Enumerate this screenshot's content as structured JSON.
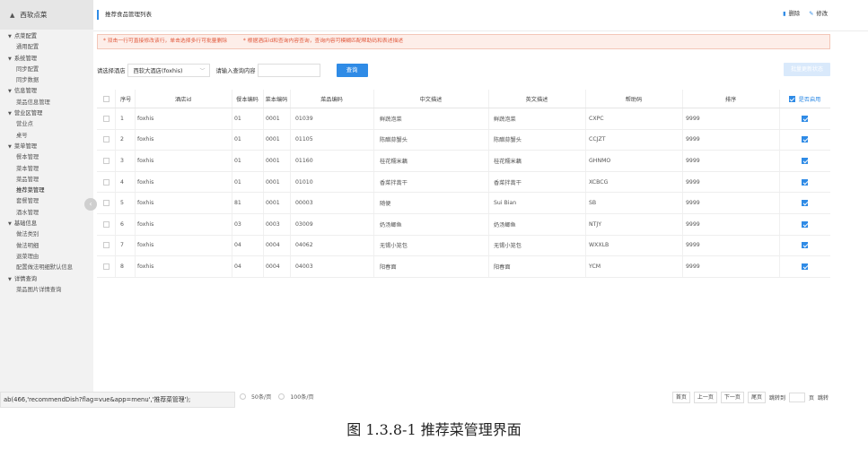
{
  "brand": {
    "title": "西软点菜",
    "icon": "home-icon"
  },
  "sidebar": {
    "items": [
      {
        "label": "点菜配置",
        "type": "group"
      },
      {
        "label": "通用配置",
        "type": "leaf"
      },
      {
        "label": "系统管理",
        "type": "group"
      },
      {
        "label": "同步配置",
        "type": "leaf"
      },
      {
        "label": "同步数据",
        "type": "leaf"
      },
      {
        "label": "信息管理",
        "type": "group"
      },
      {
        "label": "菜品信息管理",
        "type": "leaf"
      },
      {
        "label": "营业区管理",
        "type": "group"
      },
      {
        "label": "营业点",
        "type": "leaf"
      },
      {
        "label": "桌号",
        "type": "leaf"
      },
      {
        "label": "菜单管理",
        "type": "group"
      },
      {
        "label": "餐本管理",
        "type": "leaf"
      },
      {
        "label": "菜本管理",
        "type": "leaf"
      },
      {
        "label": "菜品管理",
        "type": "leaf"
      },
      {
        "label": "推荐菜管理",
        "type": "leaf",
        "active": true
      },
      {
        "label": "套餐管理",
        "type": "leaf"
      },
      {
        "label": "酒水管理",
        "type": "leaf"
      },
      {
        "label": "基础信息",
        "type": "group"
      },
      {
        "label": "做法类别",
        "type": "leaf"
      },
      {
        "label": "做法明细",
        "type": "leaf"
      },
      {
        "label": "退菜理由",
        "type": "leaf"
      },
      {
        "label": "配置做法明细默认信息",
        "type": "leaf"
      },
      {
        "label": "详情查询",
        "type": "group"
      },
      {
        "label": "菜品图片详情查询",
        "type": "leaf"
      }
    ]
  },
  "header": {
    "title": "推荐食品管理列表",
    "delete_label": "删除",
    "edit_label": "修改"
  },
  "notice": {
    "tip1": "* 双击一行可直接修改该行，单击选择多行可批量删除",
    "tip2": "* 根据酒店id和查询内容查询，查询内容可模糊匹配帮助码和表述描述"
  },
  "toolbar": {
    "hotel_label": "请选择酒店",
    "hotel_value": "西软大酒店(foxhis)",
    "search_label": "请输入查询内容",
    "search_placeholder": "",
    "search_button": "查询",
    "batch_button": "批量更新状态"
  },
  "table": {
    "headers": {
      "index": "序号",
      "hotel_id": "酒店id",
      "meal_code": "餐本编码",
      "menu_code": "菜本编码",
      "dish_code": "菜品编码",
      "cn_desc": "中文描述",
      "en_desc": "英文描述",
      "help_code": "帮助码",
      "sort": "排序",
      "enabled": "是否启用"
    },
    "rows": [
      {
        "index": "1",
        "hotel_id": "foxhis",
        "meal_code": "01",
        "menu_code": "0001",
        "dish_code": "01039",
        "cn_desc": "鲜蔬泡菜",
        "en_desc": "鲜蔬泡菜",
        "help_code": "CXPC",
        "sort": "9999",
        "enabled": true
      },
      {
        "index": "2",
        "hotel_id": "foxhis",
        "meal_code": "01",
        "menu_code": "0001",
        "dish_code": "01105",
        "cn_desc": "陈醋蒜蟹头",
        "en_desc": "陈醋蒜蟹头",
        "help_code": "CCJZT",
        "sort": "9999",
        "enabled": true
      },
      {
        "index": "3",
        "hotel_id": "foxhis",
        "meal_code": "01",
        "menu_code": "0001",
        "dish_code": "01160",
        "cn_desc": "桂花糯米藕",
        "en_desc": "桂花糯米藕",
        "help_code": "GHNMO",
        "sort": "9999",
        "enabled": true
      },
      {
        "index": "4",
        "hotel_id": "foxhis",
        "meal_code": "01",
        "menu_code": "0001",
        "dish_code": "01010",
        "cn_desc": "香菜拌蒿干",
        "en_desc": "香菜拌蒿干",
        "help_code": "XCBCG",
        "sort": "9999",
        "enabled": true
      },
      {
        "index": "5",
        "hotel_id": "foxhis",
        "meal_code": "81",
        "menu_code": "0001",
        "dish_code": "00003",
        "cn_desc": "随便",
        "en_desc": "Sui Bian",
        "help_code": "SB",
        "sort": "9999",
        "enabled": true
      },
      {
        "index": "6",
        "hotel_id": "foxhis",
        "meal_code": "03",
        "menu_code": "0003",
        "dish_code": "03009",
        "cn_desc": "奶汤鲫鱼",
        "en_desc": "奶汤鲫鱼",
        "help_code": "NTJY",
        "sort": "9999",
        "enabled": true
      },
      {
        "index": "7",
        "hotel_id": "foxhis",
        "meal_code": "04",
        "menu_code": "0004",
        "dish_code": "04062",
        "cn_desc": "无锡小笼包",
        "en_desc": "无锡小笼包",
        "help_code": "WXXLB",
        "sort": "9999",
        "enabled": true
      },
      {
        "index": "8",
        "hotel_id": "foxhis",
        "meal_code": "04",
        "menu_code": "0004",
        "dish_code": "04003",
        "cn_desc": "阳春面",
        "en_desc": "阳春面",
        "help_code": "YCM",
        "sort": "9999",
        "enabled": true
      }
    ]
  },
  "pagination": {
    "size_50": "50条/页",
    "size_100": "100条/页",
    "first": "首页",
    "prev": "上一页",
    "next": "下一页",
    "last": "尾页",
    "goto_label": "跳转到",
    "page_unit": "页",
    "goto_button": "跳转"
  },
  "status_url": "ab(466,'recommendDish?flag=vue&app=menu','推荐菜管理');",
  "caption": "图 1.3.8-1 推荐菜管理界面",
  "colors": {
    "accent": "#2f8be6",
    "notice_text": "#e0573a",
    "notice_bg": "#fdeee9"
  }
}
